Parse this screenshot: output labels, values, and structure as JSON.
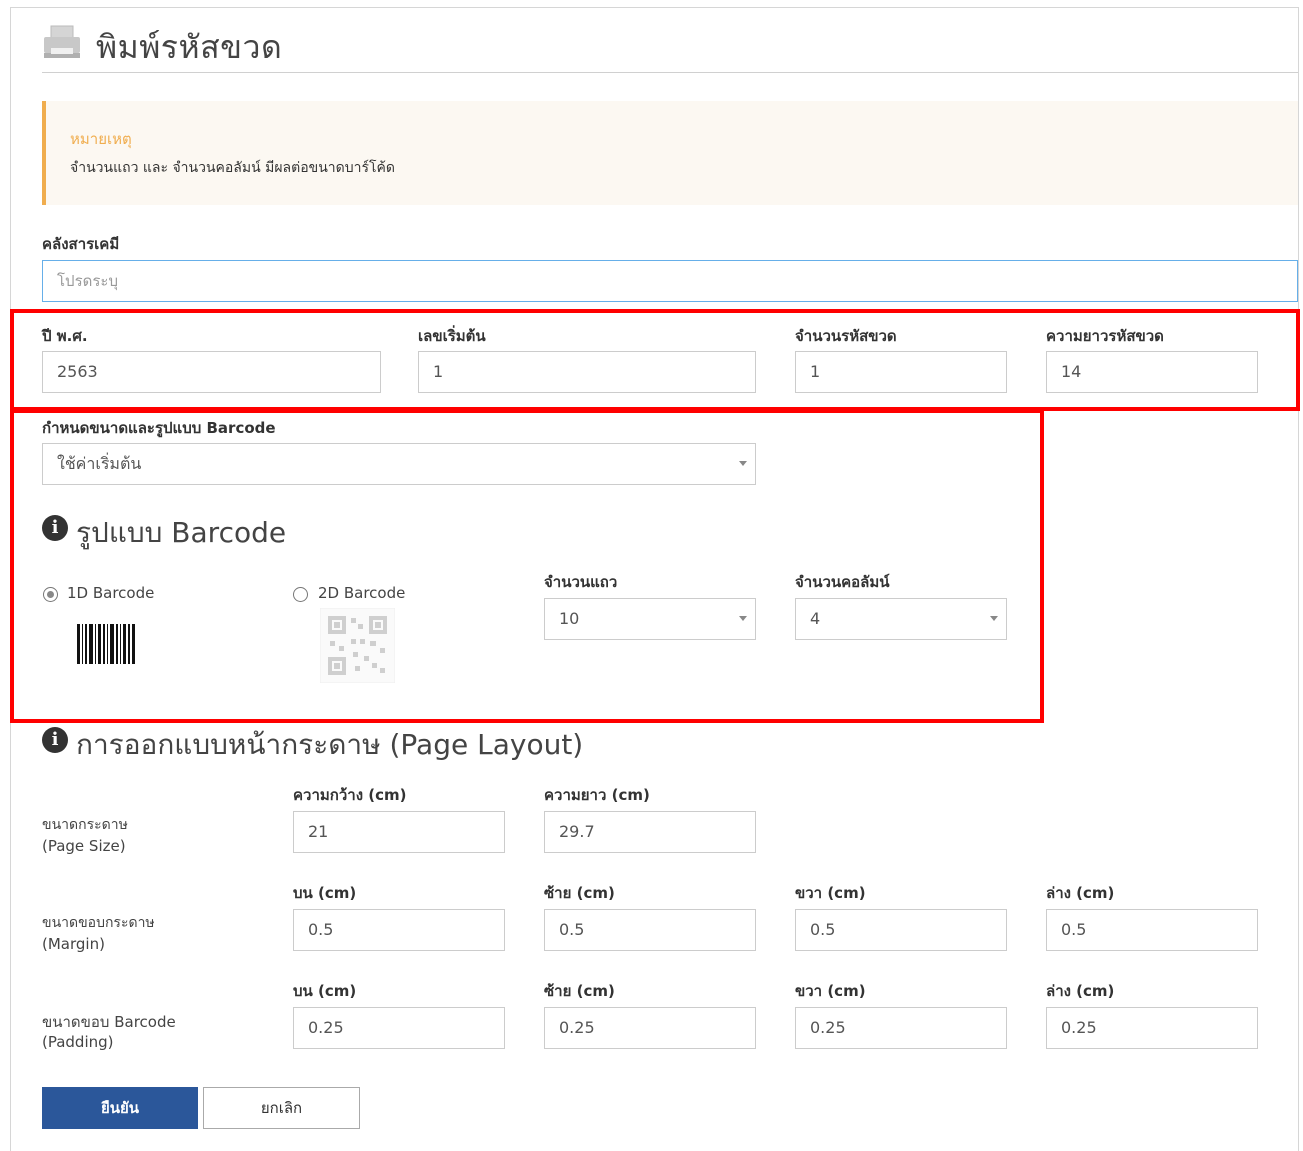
{
  "header": {
    "title": "พิมพ์รหัสขวด",
    "icon": "printer-icon"
  },
  "note": {
    "title": "หมายเหตุ",
    "text": "จำนวนแถว และ จำนวนคอลัมน์ มีผลต่อขนาดบาร์โค้ด"
  },
  "warehouse": {
    "label": "คลังสารเคมี",
    "placeholder": "โปรดระบุ"
  },
  "code_fields": [
    {
      "label": "ปี พ.ศ.",
      "value": "2563"
    },
    {
      "label": "เลขเริ่มต้น",
      "value": "1"
    },
    {
      "label": "จำนวนรหัสขวด",
      "value": "1"
    },
    {
      "label": "ความยาวรหัสขวด",
      "value": "14"
    }
  ],
  "barcode_size": {
    "label": "กำหนดขนาดและรูปแบบ Barcode",
    "selected": "ใช้ค่าเริ่มต้น"
  },
  "barcode_format": {
    "title": "รูปแบบ Barcode",
    "options": [
      {
        "label": "1D Barcode",
        "checked": true
      },
      {
        "label": "2D Barcode",
        "checked": false
      }
    ],
    "rows": {
      "label": "จำนวนแถว",
      "selected": "10"
    },
    "columns": {
      "label": "จำนวนคอลัมน์",
      "selected": "4"
    }
  },
  "page_layout": {
    "title": "การออกแบบหน้ากระดาษ (Page Layout)",
    "page_size": {
      "label_th": "ขนาดกระดาษ",
      "label_en": "(Page Size)",
      "fields": [
        {
          "label": "ความกว้าง (cm)",
          "value": "21"
        },
        {
          "label": "ความยาว (cm)",
          "value": "29.7"
        }
      ]
    },
    "margin": {
      "label_th": "ขนาดขอบกระดาษ",
      "label_en": "(Margin)",
      "fields": [
        {
          "label": "บน (cm)",
          "value": "0.5"
        },
        {
          "label": "ซ้าย (cm)",
          "value": "0.5"
        },
        {
          "label": "ขวา (cm)",
          "value": "0.5"
        },
        {
          "label": "ล่าง (cm)",
          "value": "0.5"
        }
      ]
    },
    "padding": {
      "label_th": "ขนาดขอบ Barcode",
      "label_en": "(Padding)",
      "fields": [
        {
          "label": "บน (cm)",
          "value": "0.25"
        },
        {
          "label": "ซ้าย (cm)",
          "value": "0.25"
        },
        {
          "label": "ขวา (cm)",
          "value": "0.25"
        },
        {
          "label": "ล่าง (cm)",
          "value": "0.25"
        }
      ]
    }
  },
  "actions": {
    "confirm": "ยืนยัน",
    "cancel": "ยกเลิก"
  },
  "colors": {
    "primary": "#2b579a",
    "warning": "#f0ad4e",
    "highlight": "#ff0000"
  }
}
